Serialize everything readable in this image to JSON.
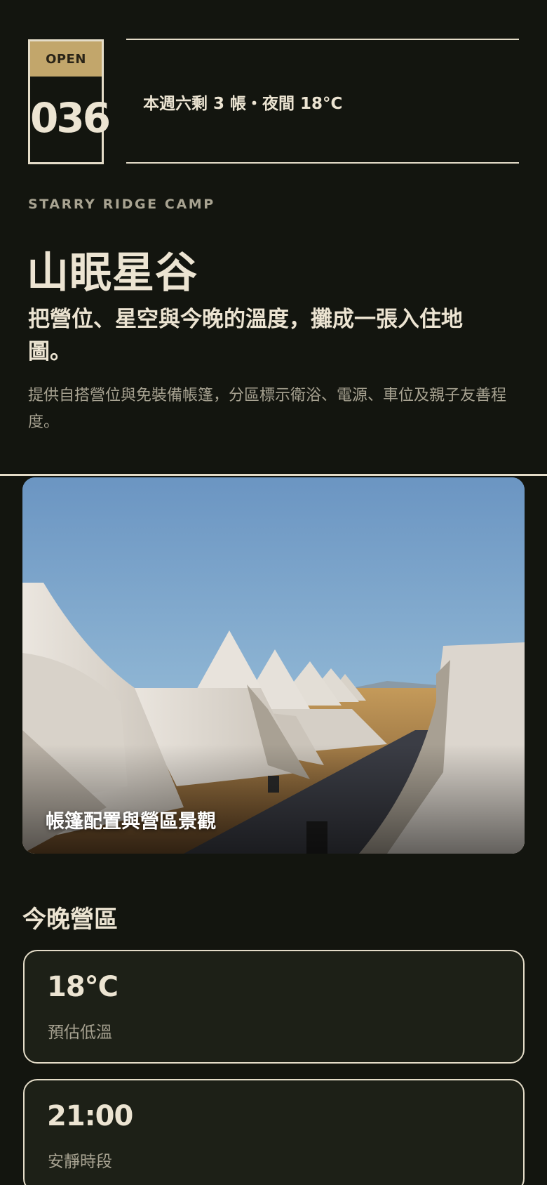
{
  "header": {
    "open_label": "OPEN",
    "day_number": "036",
    "status_text": "本週六剩 3 帳・夜間 18°C"
  },
  "brand": {
    "name_en": "STARRY RIDGE CAMP",
    "title": "山眠星谷",
    "tagline": "把營位、星空與今晚的溫度，攤成一張入住地圖。",
    "description": "提供自搭營位與免裝備帳篷，分區標示衛浴、電源、車位及親子友善程度。"
  },
  "photo": {
    "caption": "帳篷配置與營區景觀"
  },
  "tonight": {
    "title": "今晚營區",
    "stats": [
      {
        "value": "18°C",
        "label": "預估低溫"
      },
      {
        "value": "21:00",
        "label": "安靜時段"
      }
    ]
  },
  "colors": {
    "background": "#13150f",
    "accent_gold": "#c2a66b",
    "text_primary": "#ece4d2",
    "text_muted": "#a7a291",
    "border": "#e4dcc8"
  }
}
